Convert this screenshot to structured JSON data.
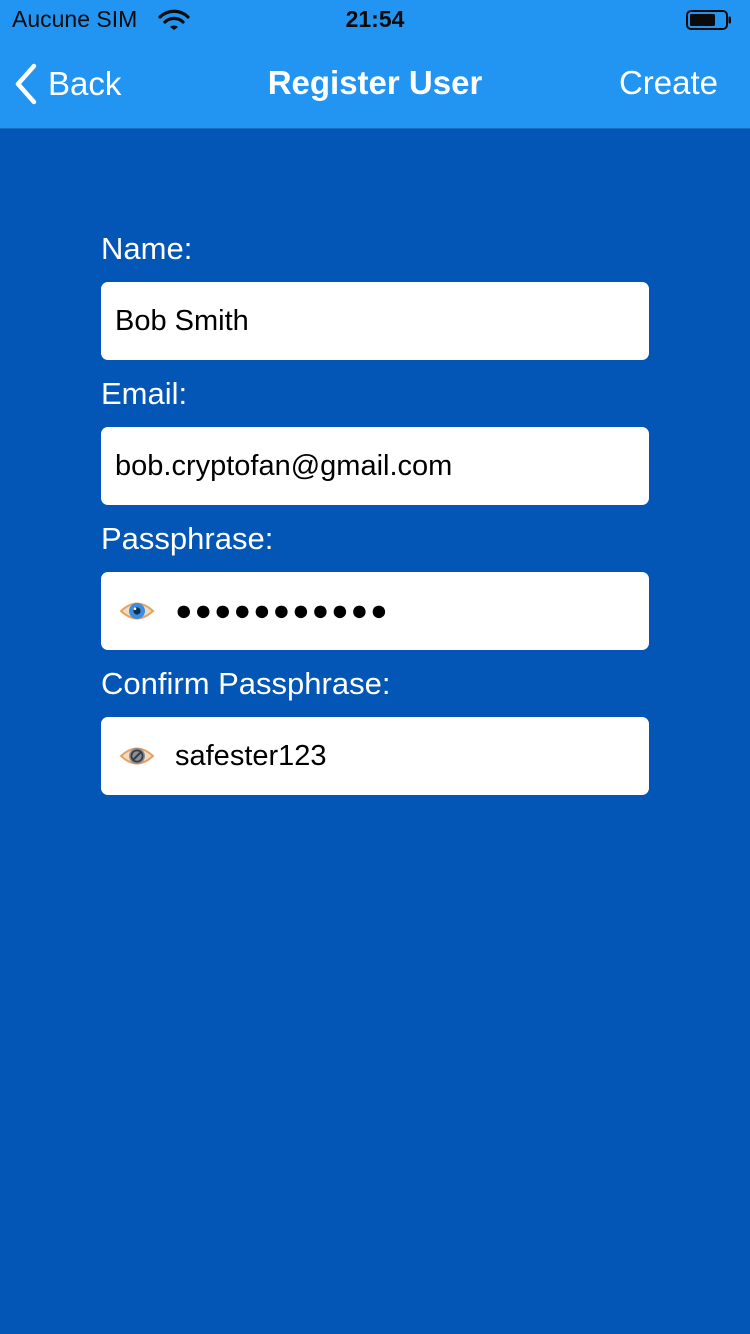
{
  "status_bar": {
    "carrier": "Aucune SIM",
    "time": "21:54"
  },
  "nav": {
    "back_label": "Back",
    "title": "Register User",
    "create_label": "Create"
  },
  "form": {
    "name": {
      "label": "Name:",
      "value": "Bob Smith"
    },
    "email": {
      "label": "Email:",
      "value": "bob.cryptofan@gmail.com"
    },
    "passphrase": {
      "label": "Passphrase:",
      "masked_value": "●●●●●●●●●●●",
      "visibility_icon": "eye-icon"
    },
    "confirm_passphrase": {
      "label": "Confirm Passphrase:",
      "value": "safester123",
      "visibility_icon": "eye-slash-icon"
    }
  },
  "colors": {
    "nav_background": "#2294f2",
    "page_background": "#0356b5",
    "field_background": "#ffffff"
  }
}
